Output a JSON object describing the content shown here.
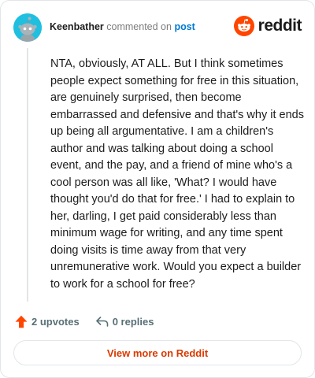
{
  "header": {
    "author": "Keenbather",
    "verb": "commented on",
    "target": "post",
    "brand": "reddit",
    "avatar_icon": "snoo-avatar-icon",
    "brand_icon": "reddit-logo-icon"
  },
  "comment": {
    "text": "NTA, obviously, AT ALL. But I think sometimes people expect something for free in this situation, are genuinely surprised, then become embarrassed and defensive and that's why it ends up being all argumentative. I am a children's author and was talking about doing a school event, and the pay, and a friend of mine who's a cool person was all like, 'What? I would have thought you'd do that for free.' I had to explain to her, darling, I get paid considerably less than minimum wage for writing, and any time spent doing visits is time away from that very unremunerative work. Would you expect a builder to work for a school for free?"
  },
  "actions": {
    "upvotes": "2 upvotes",
    "replies": "0 replies",
    "upvote_icon": "upvote-arrow-icon",
    "reply_icon": "reply-arrow-icon"
  },
  "footer": {
    "view_more": "View more on Reddit"
  },
  "colors": {
    "brand_orange": "#ff4500",
    "link_blue": "#0079d3",
    "view_more_text": "#d93a00",
    "avatar_bg": "#1fbfe0"
  }
}
